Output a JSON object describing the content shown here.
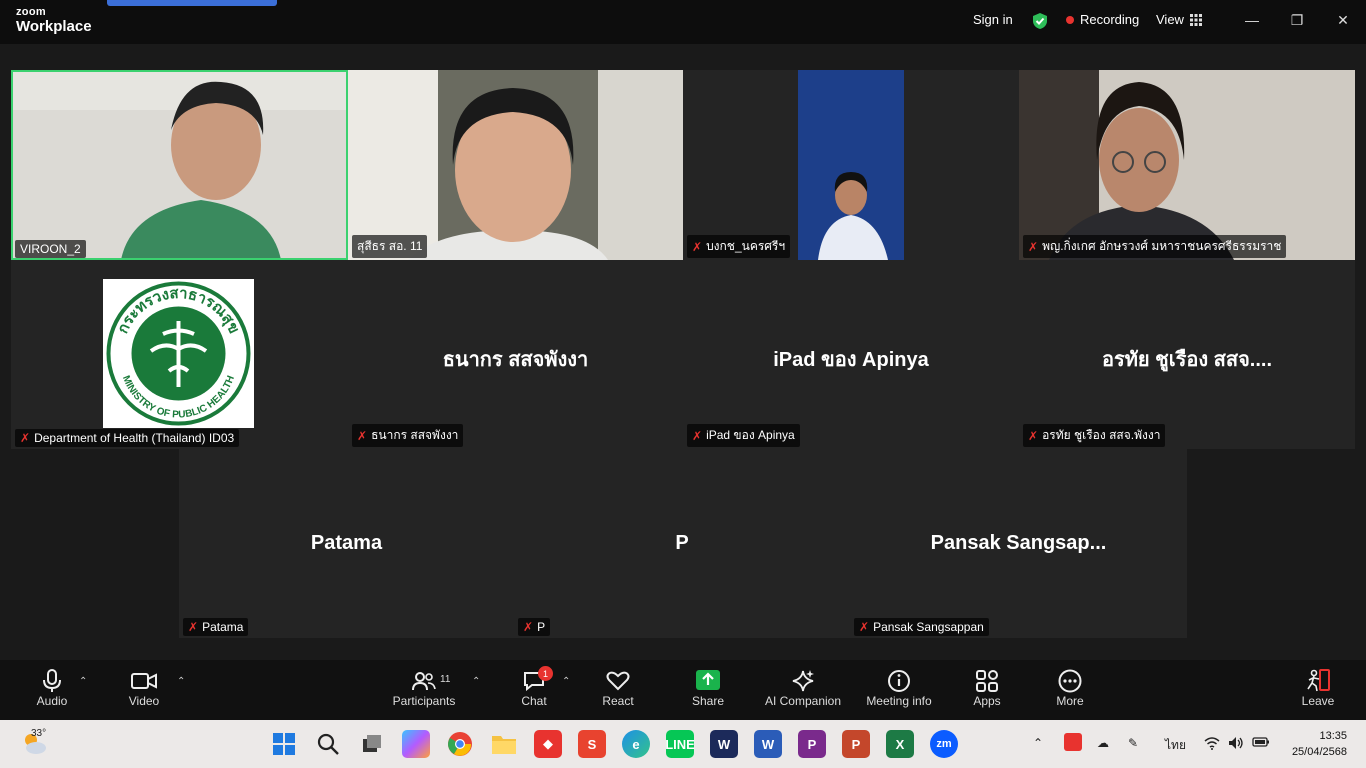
{
  "titlebar": {
    "brand_line1": "zoom",
    "brand_line2": "Workplace",
    "sign_in": "Sign in",
    "recording": "Recording",
    "view": "View"
  },
  "tiles": [
    {
      "name": "VIROON_2",
      "type": "video",
      "muted": false
    },
    {
      "name": "สุสีธร สอ. 11",
      "type": "video",
      "muted": false
    },
    {
      "name": "บงกช_นครศรีฯ",
      "type": "video",
      "muted": true
    },
    {
      "name": "พญ.กิ่งเกศ อักษรวงศ์ มหาราชนครศรีธรรมราช",
      "type": "video",
      "muted": true
    },
    {
      "name": "Department of Health (Thailand) ID03",
      "type": "logo",
      "muted": true,
      "logo_text": "MINISTRY OF PUBLIC HEALTH",
      "logo_thai": "กระทรวงสาธารณสุข"
    },
    {
      "name": "ธนากร สสจพังงา",
      "display": "ธนากร สสจพังงา",
      "type": "name",
      "muted": true
    },
    {
      "name": "iPad ของ Apinya",
      "display": "iPad ของ Apinya",
      "type": "name",
      "muted": true
    },
    {
      "name": "อรทัย ชูเรือง สสจ.พังงา",
      "display": "อรทัย ชูเรือง สสจ....",
      "type": "name",
      "muted": true
    },
    {
      "name": "Patama",
      "display": "Patama",
      "type": "name",
      "muted": true
    },
    {
      "name": "P",
      "display": "P",
      "type": "name",
      "muted": true
    },
    {
      "name": "Pansak Sangsappan",
      "display": "Pansak Sangsap...",
      "type": "name",
      "muted": true
    }
  ],
  "toolbar": {
    "audio": "Audio",
    "video": "Video",
    "participants": "Participants",
    "participants_count": "11",
    "chat": "Chat",
    "chat_badge": "1",
    "react": "React",
    "share": "Share",
    "ai_companion": "AI Companion",
    "meeting_info": "Meeting info",
    "apps": "Apps",
    "more": "More",
    "leave": "Leave"
  },
  "taskbar": {
    "weather": "33°",
    "language": "ไทย",
    "time": "13:35",
    "date": "25/04/2568",
    "apps": [
      "start",
      "search",
      "task-view",
      "copilot",
      "chrome",
      "file-explorer",
      "anydesk",
      "sketch",
      "edge",
      "line",
      "clipchamp",
      "word",
      "pdf",
      "powerpoint",
      "excel",
      "zoom"
    ]
  },
  "colors": {
    "active_speaker": "#3bd16f",
    "muted_red": "#e8332f",
    "share_green": "#1ab34c",
    "moph_green": "#1a7a3a"
  }
}
